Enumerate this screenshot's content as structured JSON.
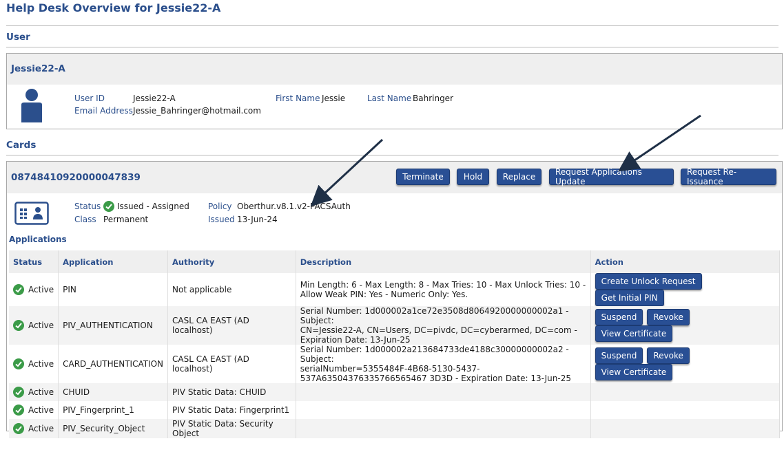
{
  "page": {
    "title": "Help Desk Overview for Jessie22-A"
  },
  "sections": {
    "user": "User",
    "cards": "Cards",
    "applications": "Applications"
  },
  "user": {
    "name": "Jessie22-A",
    "user_id_label": "User ID",
    "user_id": "Jessie22-A",
    "email_label": "Email Address",
    "email": "Jessie_Bahringer@hotmail.com",
    "first_name_label": "First Name",
    "first_name": "Jessie",
    "last_name_label": "Last Name",
    "last_name": "Bahringer"
  },
  "card": {
    "number": "08748410920000047839",
    "buttons": {
      "terminate": "Terminate",
      "hold": "Hold",
      "replace": "Replace",
      "request_apps_update": "Request Applications Update",
      "request_reissuance": "Request Re-Issuance"
    },
    "status_label": "Status",
    "status": "Issued - Assigned",
    "class_label": "Class",
    "class": "Permanent",
    "policy_label": "Policy",
    "policy": "Oberthur.v8.1.v2-PACSAuth",
    "issued_label": "Issued",
    "issued": "13-Jun-24"
  },
  "applications": {
    "headers": {
      "status": "Status",
      "application": "Application",
      "authority": "Authority",
      "description": "Description",
      "action": "Action"
    },
    "rows": [
      {
        "status": "Active",
        "application": "PIN",
        "authority": "Not applicable",
        "description": [
          "Min Length: 6 - Max Length: 8 - Max Tries: 10 - Max Unlock Tries: 10 -",
          "Allow Weak PIN: Yes - Numeric Only: Yes."
        ],
        "actions": [
          "Create Unlock Request",
          "Get Initial PIN"
        ]
      },
      {
        "status": "Active",
        "application": "PIV_AUTHENTICATION",
        "authority": "CASL CA EAST (AD localhost)",
        "description": [
          "Serial Number: 1d000002a1ce72e3508d8064920000000002a1 - Subject:",
          "CN=Jessie22-A, CN=Users, DC=pivdc, DC=cyberarmed, DC=com -",
          "Expiration Date: 13-Jun-25"
        ],
        "actions": [
          "Suspend",
          "Revoke",
          "View Certificate"
        ]
      },
      {
        "status": "Active",
        "application": "CARD_AUTHENTICATION",
        "authority": "CASL CA EAST (AD localhost)",
        "description": [
          "Serial Number: 1d000002a213684733de4188c30000000002a2 - Subject:",
          "serialNumber=5355484F-4B68-5130-5437-",
          "537A63504376335766565467 3D3D - Expiration Date: 13-Jun-25"
        ],
        "actions": [
          "Suspend",
          "Revoke",
          "View Certificate"
        ]
      },
      {
        "status": "Active",
        "application": "CHUID",
        "authority": "PIV Static Data: CHUID",
        "description": [],
        "actions": []
      },
      {
        "status": "Active",
        "application": "PIV_Fingerprint_1",
        "authority": "PIV Static Data: Fingerprint1",
        "description": [],
        "actions": []
      },
      {
        "status": "Active",
        "application": "PIV_Security_Object",
        "authority": "PIV Static Data: Security Object",
        "description": [],
        "actions": []
      }
    ]
  },
  "colors": {
    "brand": "#2b4f8c",
    "button": "#294f94",
    "success": "#3b9b48",
    "arrow": "#1f3047"
  },
  "icons": {
    "avatar": "person-icon",
    "card": "id-card-icon",
    "ok": "check-circle-icon"
  }
}
